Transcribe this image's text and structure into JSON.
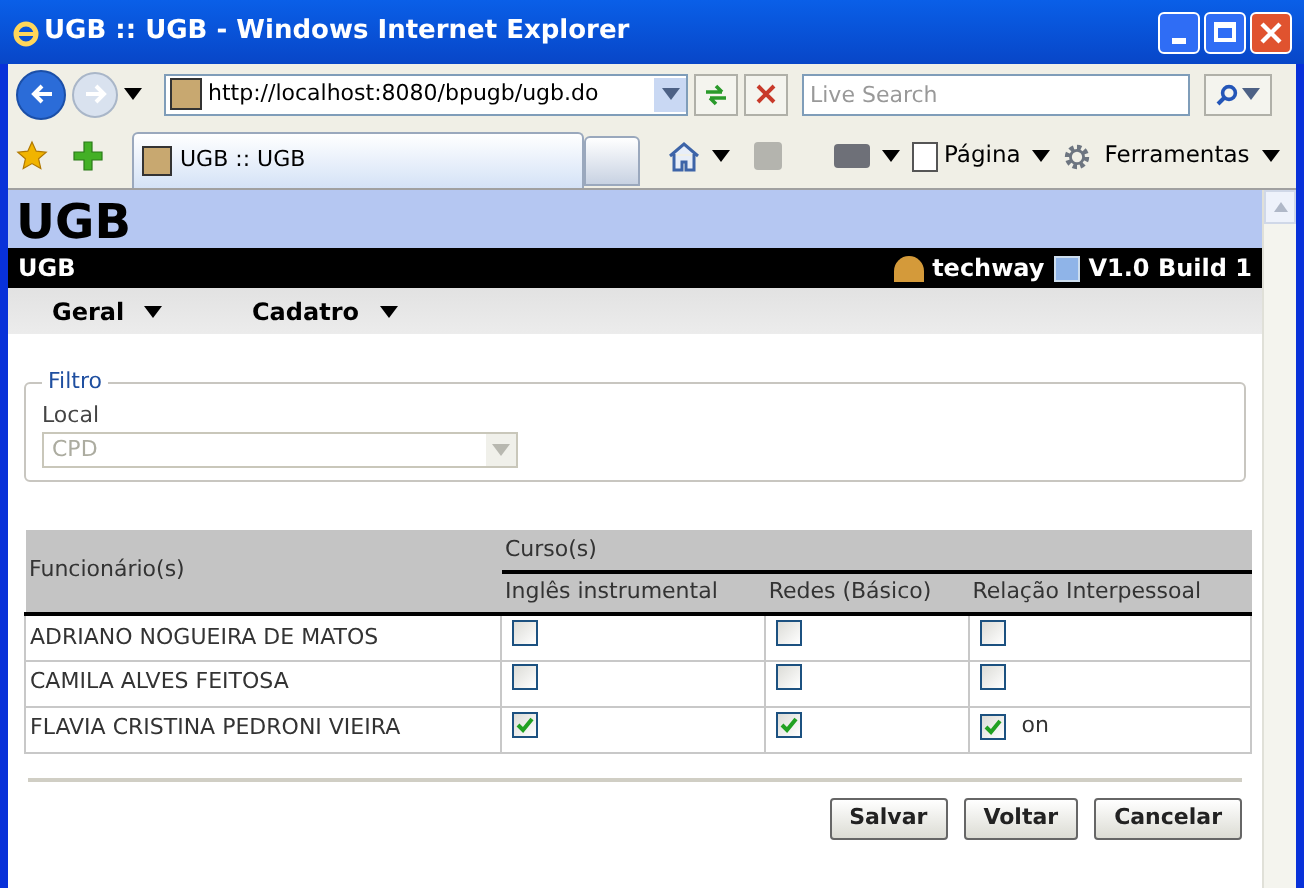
{
  "window": {
    "title": "UGB :: UGB - Windows Internet Explorer"
  },
  "browser": {
    "address": "http://localhost:8080/bpugb/ugb.do",
    "search_placeholder": "Live Search",
    "tab_title": "UGB :: UGB",
    "toolbar": [
      "Página",
      "Ferramentas"
    ]
  },
  "page": {
    "header": "UGB",
    "bar": {
      "app": "UGB",
      "user": "techway",
      "version": "V1.0 Build 1"
    },
    "menu": [
      "Geral",
      "Cadatro"
    ],
    "filter": {
      "legend": "Filtro",
      "label": "Local",
      "value": "CPD",
      "disabled": true
    },
    "table": {
      "group_header": "Curso(s)",
      "columns": [
        "Funcionário(s)",
        "Inglês instrumental",
        "Redes (Básico)",
        "Relação Interpessoal"
      ],
      "rows": [
        {
          "name": "ADRIANO NOGUEIRA DE MATOS",
          "checks": [
            false,
            false,
            false
          ]
        },
        {
          "name": "CAMILA ALVES FEITOSA",
          "checks": [
            false,
            false,
            false
          ]
        },
        {
          "name": "FLAVIA CRISTINA PEDRONI VIEIRA",
          "checks": [
            true,
            true,
            true
          ],
          "note": "on"
        }
      ]
    },
    "buttons": [
      "Salvar",
      "Voltar",
      "Cancelar"
    ]
  }
}
